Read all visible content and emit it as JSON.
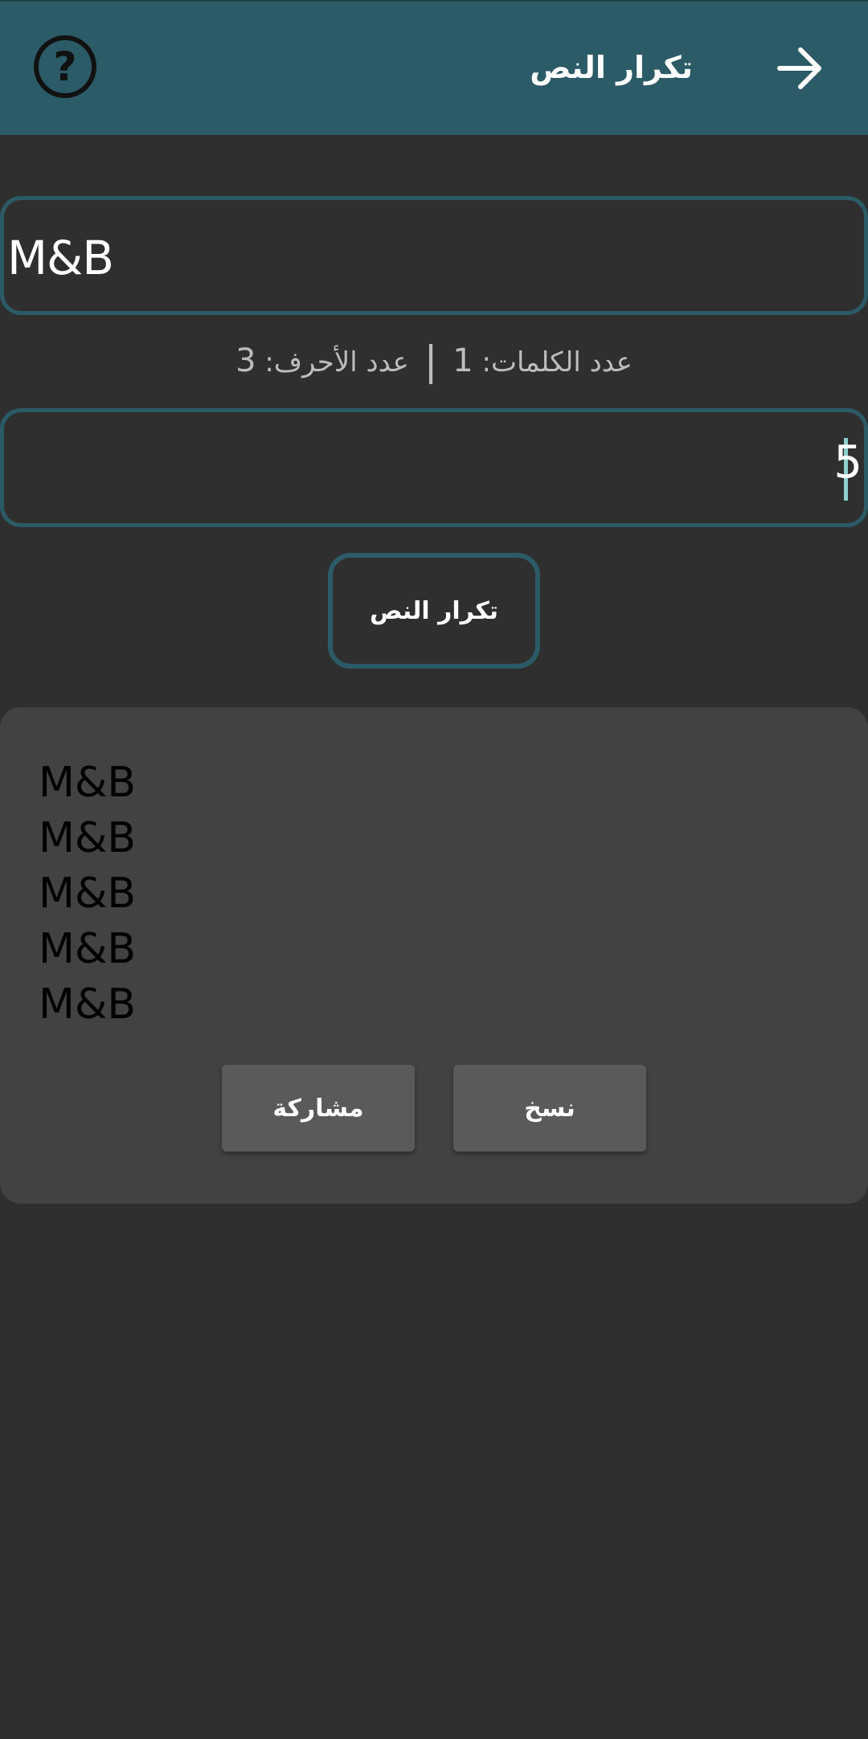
{
  "appbar": {
    "title": "تكرار النص",
    "help_glyph": "?",
    "help_icon": "help-circle-icon",
    "back_icon": "arrow-right-icon"
  },
  "input": {
    "text": "M&B"
  },
  "stats": {
    "words_label": "عدد الكلمات:",
    "words_value": "1",
    "separator": "|",
    "chars_label": "عدد الأحرف:",
    "chars_value": "3"
  },
  "repeat_count": {
    "value": "5"
  },
  "repeat_button": {
    "label": "تكرار النص"
  },
  "result": {
    "lines": [
      "M&B",
      "M&B",
      "M&B",
      "M&B",
      "M&B"
    ],
    "copy_label": "نسخ",
    "share_label": "مشاركة"
  },
  "colors": {
    "appbar": "#2b5b66",
    "background": "#2f2f2f",
    "card": "#424242",
    "button": "#5a5a5b",
    "cursor": "#8fd0cf"
  }
}
